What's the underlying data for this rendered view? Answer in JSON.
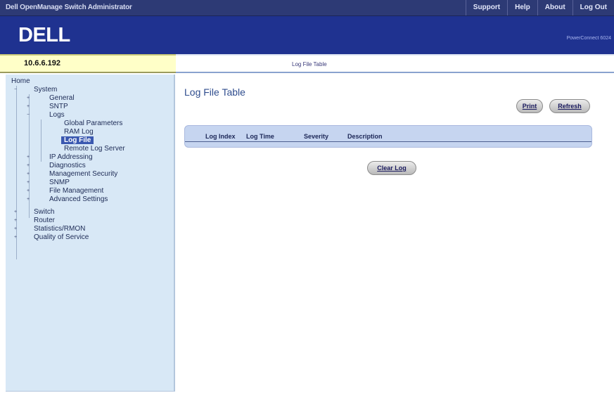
{
  "app": {
    "title": "Dell OpenManage Switch Administrator",
    "logo": "DELL",
    "model": "PowerConnect 6024"
  },
  "topnav": {
    "items": [
      {
        "label": "Support"
      },
      {
        "label": "Help"
      },
      {
        "label": "About"
      },
      {
        "label": "Log Out"
      }
    ]
  },
  "ipbar": {
    "ip": "10.6.6.192"
  },
  "breadcrumb": {
    "current": "Log File Table"
  },
  "tree": {
    "items": [
      {
        "label": "Home"
      },
      {
        "label": "System"
      },
      {
        "label": "General"
      },
      {
        "label": "SNTP"
      },
      {
        "label": "Logs"
      },
      {
        "label": "Global Parameters"
      },
      {
        "label": "RAM Log"
      },
      {
        "label": "Log File"
      },
      {
        "label": "Remote Log Server"
      },
      {
        "label": "IP Addressing"
      },
      {
        "label": "Diagnostics"
      },
      {
        "label": "Management Security"
      },
      {
        "label": "SNMP"
      },
      {
        "label": "File Management"
      },
      {
        "label": "Advanced Settings"
      },
      {
        "label": "Switch"
      },
      {
        "label": "Router"
      },
      {
        "label": "Statistics/RMON"
      },
      {
        "label": "Quality of Service"
      }
    ],
    "selected": "Log File"
  },
  "page": {
    "title": "Log File Table",
    "print_label": "Print",
    "refresh_label": "Refresh",
    "clear_log_label": "Clear Log",
    "columns": [
      "Log Index",
      "Log Time",
      "Severity",
      "Description"
    ],
    "rows": []
  },
  "colors": {
    "titlebar": "#2d3a75",
    "banner": "#1f3290",
    "ipbar": "#ffffc8",
    "sidebar": "#d8e8f6",
    "table_header": "#c6d5f0",
    "selected_item": "#3a58b0"
  }
}
